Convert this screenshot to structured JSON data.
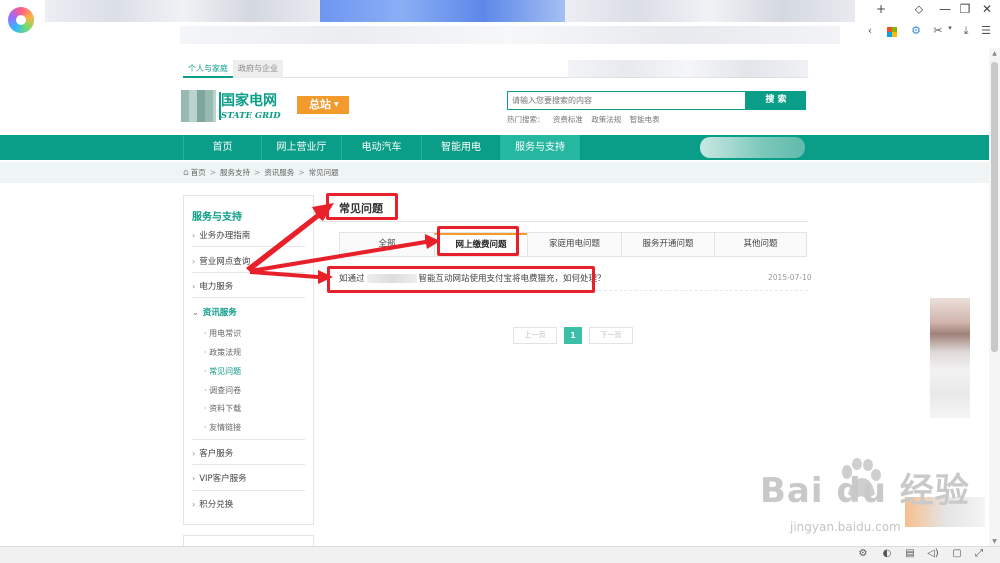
{
  "browser": {
    "win_controls": [
      "+",
      "⬦",
      "—",
      "❐",
      "✕"
    ],
    "toolbar_icons": [
      "‹",
      "⚙",
      "✂",
      "▾",
      "⤓",
      "☰"
    ]
  },
  "site": {
    "top_tabs": {
      "personal": "个人与家庭",
      "government": "政府与企业"
    },
    "logo": {
      "cn": "国家电网",
      "en": "STATE GRID"
    },
    "station": {
      "label": "总站",
      "caret": "▼"
    },
    "search": {
      "placeholder": "请输入您要搜索的内容",
      "button": "搜 索"
    },
    "hot_search": {
      "label": "热门搜索：",
      "terms": [
        "资费标准",
        "政策法规",
        "智能电表"
      ]
    },
    "nav": [
      "首页",
      "网上营业厅",
      "电动汽车",
      "智能用电",
      "服务与支持"
    ],
    "breadcrumb": [
      "首页",
      "服务支持",
      "资讯服务",
      "常见问题"
    ]
  },
  "sidebar": {
    "title": "服务与支持",
    "items": [
      "业务办理指南",
      "营业网点查询",
      "电力服务",
      "资讯服务",
      "客户服务",
      "VIP客户服务",
      "积分兑换"
    ],
    "sub_items": [
      "用电常识",
      "政策法规",
      "常见问题",
      "调查问卷",
      "资料下载",
      "友情链接"
    ]
  },
  "content": {
    "title": "常见问题",
    "tabs": [
      "全部",
      "网上缴费问题",
      "家庭用电问题",
      "服务开通问题",
      "其他问题"
    ],
    "faq": {
      "prefix": "如通过",
      "text": "智能互动网站使用支付宝将电费猫充，如何处理？",
      "date": "2015-07-10"
    },
    "pager": {
      "prev": "上一页",
      "current": "1",
      "next": "下一页"
    }
  },
  "watermark": {
    "main": "Bai du 经验",
    "sub": "jingyan.baidu.com"
  },
  "status_icons": [
    "⚙",
    "◐",
    "▤",
    "◁)",
    "▢",
    "⤢"
  ]
}
